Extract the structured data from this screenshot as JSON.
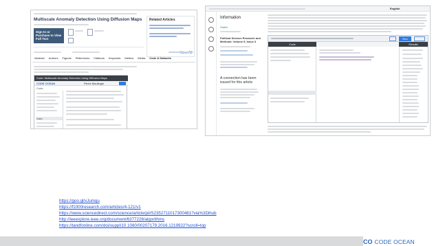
{
  "left_screenshot": {
    "title": "Multiscale Anomaly Detection Using Diffusion Maps",
    "sign_in_button": "Sign In or Purchase to View Full Text",
    "related_articles": "Related Articles",
    "view_all": "View All",
    "tabs": [
      "Abstract",
      "Authors",
      "Figures",
      "References",
      "Citations",
      "Keywords",
      "Metrics",
      "Media",
      "Code & Datasets"
    ],
    "codeocean_bar": "Code: Multiscale Anomaly Detection Using Diffusion Maps",
    "codeocean_brand": "CODE OCEAN",
    "code_header": "Code",
    "author_header": "Pierre Moulinger",
    "data_header": "Data"
  },
  "right_screenshot": {
    "information_header": "Information",
    "status": "Stable",
    "article_title": "Political Science Research and Methods: Volume 5, Issue 3",
    "connection_title": "A connection has been issued for this article",
    "code_tab": "Code",
    "results_tab": "Results",
    "language_selector": "English",
    "run_button": "Run"
  },
  "links": [
    "https://goo.gl/xJumqu",
    "https://f1000research.com/articles/4-121/v1",
    "https://www.sciencedirect.com/science/article/pii/S2352711017300481?via%3Dihub",
    "http://ieeexplore.ieee.org/document/6377228/algorithms",
    "https://tandfonline.com/doi/suppl/10.1080/00207179.2016.1219922?scroll=top"
  ],
  "footer": {
    "brand_mark": "CO",
    "brand_name": "CODE OCEAN"
  },
  "colors": {
    "link": "#1f4fd6",
    "ieee_header": "#3e5a7a",
    "footer_bar": "#d9dadc",
    "brand": "#2b65b8"
  }
}
